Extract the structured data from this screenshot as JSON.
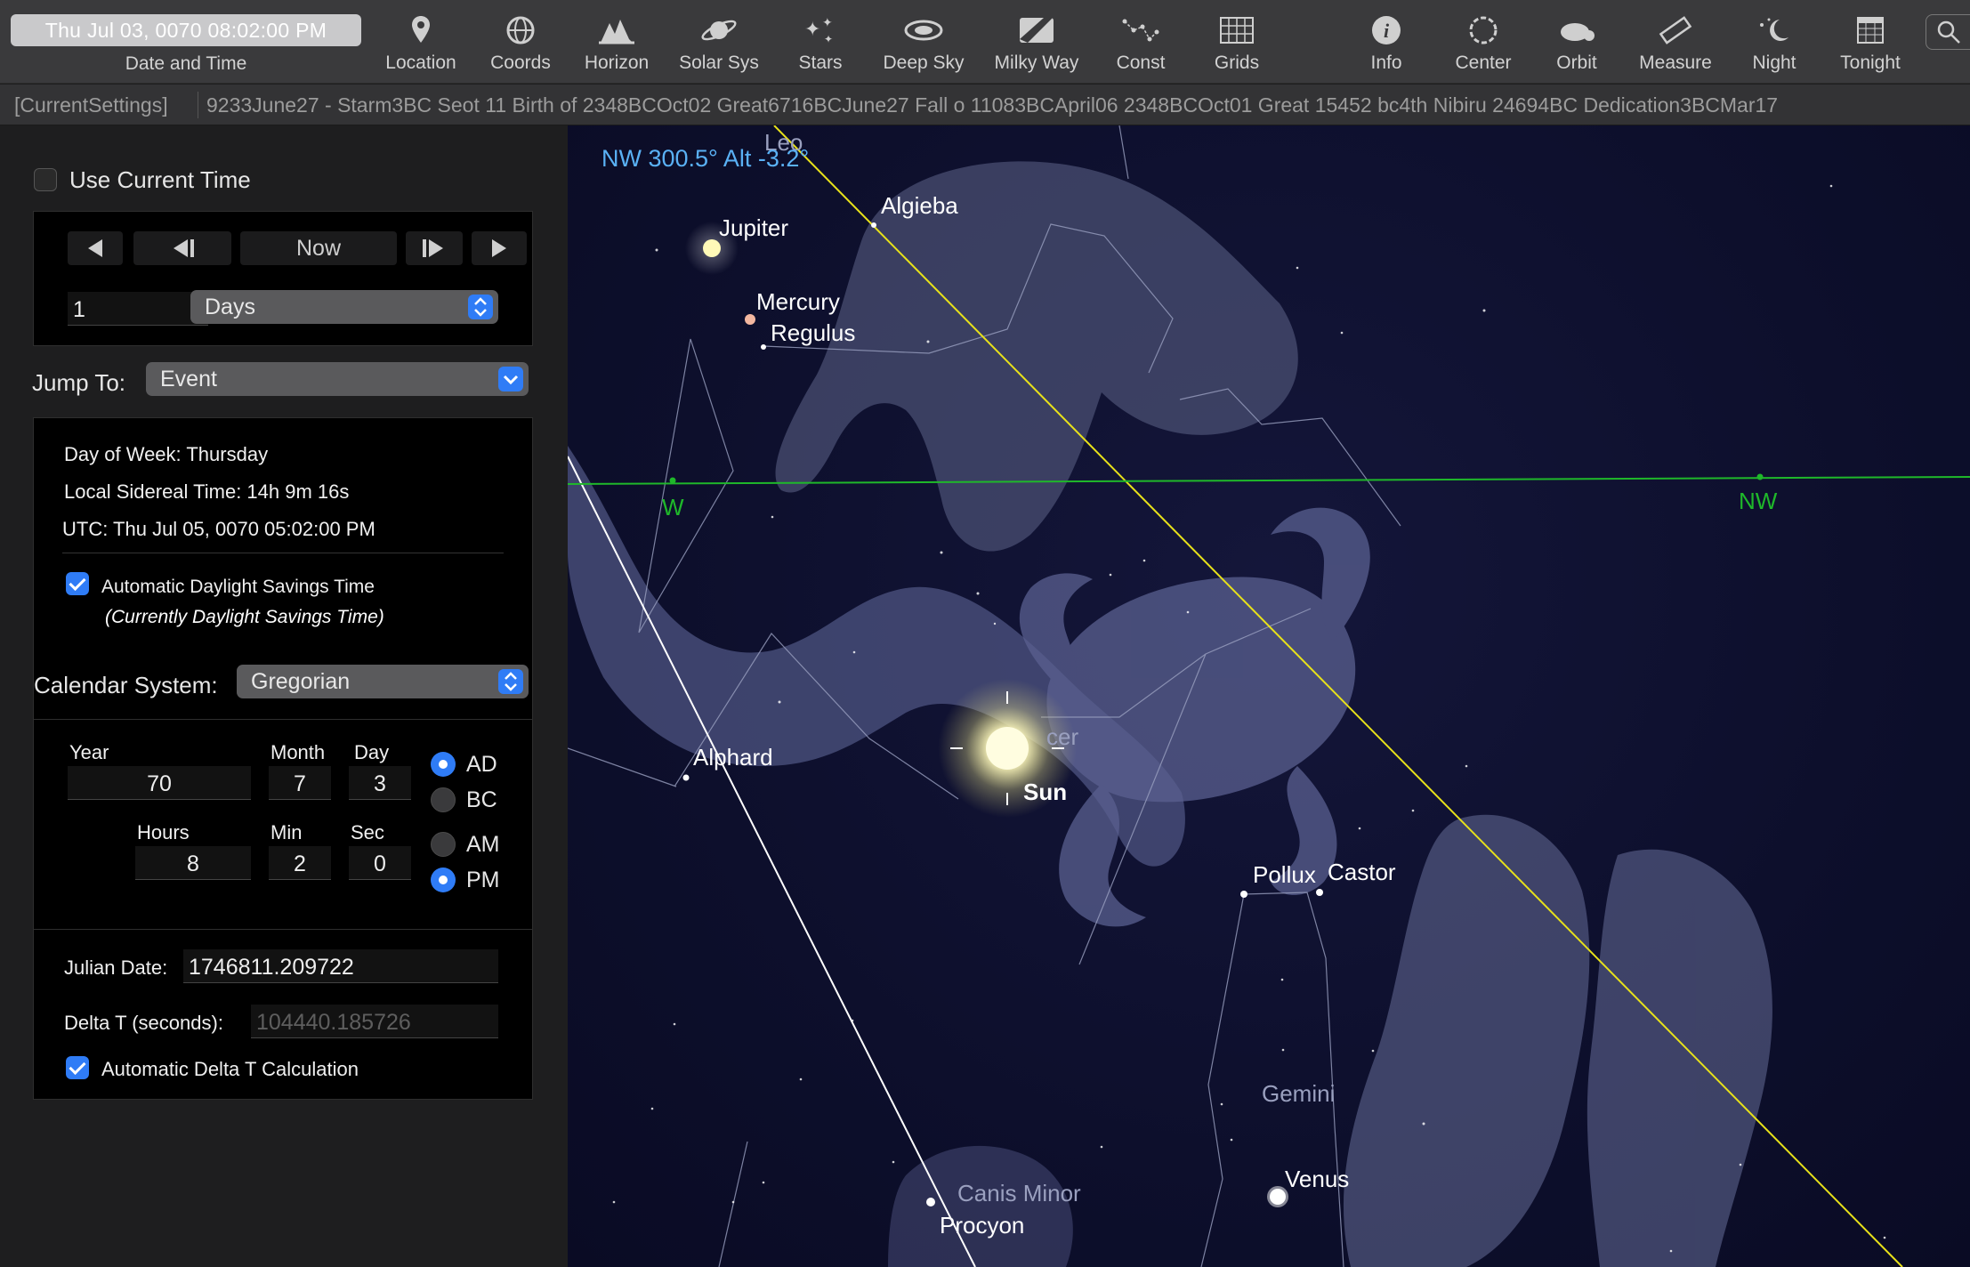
{
  "toolbar": {
    "datetime_display": "Thu Jul 03, 0070  08:02:00 PM",
    "datetime_label": "Date and Time",
    "buttons": [
      {
        "label": "Location",
        "icon": "location-pin-icon"
      },
      {
        "label": "Coords",
        "icon": "coords-icon"
      },
      {
        "label": "Horizon",
        "icon": "horizon-icon"
      },
      {
        "label": "Solar Sys",
        "icon": "planet-icon"
      },
      {
        "label": "Stars",
        "icon": "stars-icon"
      },
      {
        "label": "Deep Sky",
        "icon": "galaxy-icon"
      },
      {
        "label": "Milky Way",
        "icon": "milky-way-icon"
      },
      {
        "label": "Const",
        "icon": "constellation-icon"
      },
      {
        "label": "Grids",
        "icon": "grid-icon"
      },
      {
        "label": "Info",
        "icon": "info-icon"
      },
      {
        "label": "Center",
        "icon": "center-icon"
      },
      {
        "label": "Orbit",
        "icon": "orbit-icon"
      },
      {
        "label": "Measure",
        "icon": "ruler-icon"
      },
      {
        "label": "Night",
        "icon": "night-icon"
      },
      {
        "label": "Tonight",
        "icon": "calendar-icon"
      }
    ]
  },
  "events_bar": {
    "current": "[CurrentSettings]",
    "ticker": "9233June27 - Starm3BC Seot 11 Birth of 2348BCOct02 Great6716BCJune27 Fall o    11083BCApril06    2348BCOct01 Great  15452 bc4th Nibiru 24694BC Dedication3BCMar17"
  },
  "panel": {
    "use_current_time": "Use Current Time",
    "now_label": "Now",
    "step_value": "1",
    "step_unit": "Days",
    "jump_to_label": "Jump To:",
    "jump_to_value": "Event",
    "day_of_week": "Day of Week:  Thursday",
    "sidereal": "Local Sidereal Time:  14h 9m 16s",
    "utc": "UTC:  Thu Jul 05, 0070  05:02:00 PM",
    "auto_dst": "Automatic Daylight Savings Time",
    "dst_note": "(Currently Daylight Savings Time)",
    "calendar_label": "Calendar System:",
    "calendar_value": "Gregorian",
    "year_label": "Year",
    "year": "70",
    "month_label": "Month",
    "month": "7",
    "day_label": "Day",
    "day": "3",
    "hours_label": "Hours",
    "hours": "8",
    "min_label": "Min",
    "min": "2",
    "sec_label": "Sec",
    "sec": "0",
    "ad": "AD",
    "bc": "BC",
    "am": "AM",
    "pm": "PM",
    "julian_label": "Julian Date:",
    "julian": "1746811.209722",
    "delta_label": "Delta T (seconds):",
    "delta": "104440.185726",
    "auto_delta": "Automatic Delta T Calculation"
  },
  "sky": {
    "readout": "NW 300.5° Alt -3.2°",
    "labels": {
      "leo": "Leo",
      "jupiter": "Jupiter",
      "algieba": "Algieba",
      "mercury": "Mercury",
      "regulus": "Regulus",
      "w": "W",
      "nw": "NW",
      "alphard": "Alphard",
      "cancer": "cer",
      "sun": "Sun",
      "pollux": "Pollux",
      "castor": "Castor",
      "gemini": "Gemini",
      "venus": "Venus",
      "canis_minor": "Canis Minor",
      "procyon": "Procyon"
    },
    "colors": {
      "ecliptic": "#e8e21a",
      "horizon": "#1fb82a",
      "meridian": "#ffffff",
      "readout": "#5ab1f5"
    }
  }
}
